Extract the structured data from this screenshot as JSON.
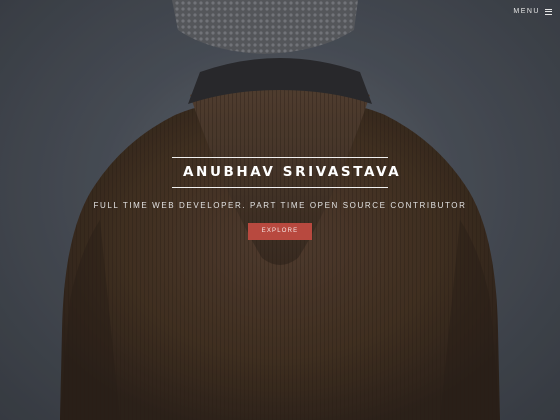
{
  "nav": {
    "menu_label": "MENU",
    "menu_icon": "hamburger-icon"
  },
  "hero": {
    "title": "ANUBHAV SRIVASTAVA",
    "tagline": "FULL TIME WEB DEVELOPER. PART TIME OPEN SOURCE CONTRIBUTOR",
    "cta_label": "EXPLORE"
  },
  "colors": {
    "background": "#4f545d",
    "jacket": "#4a3424",
    "scarf": "#2b2a2c",
    "cta": "#b8493f",
    "text": "#ffffff"
  }
}
